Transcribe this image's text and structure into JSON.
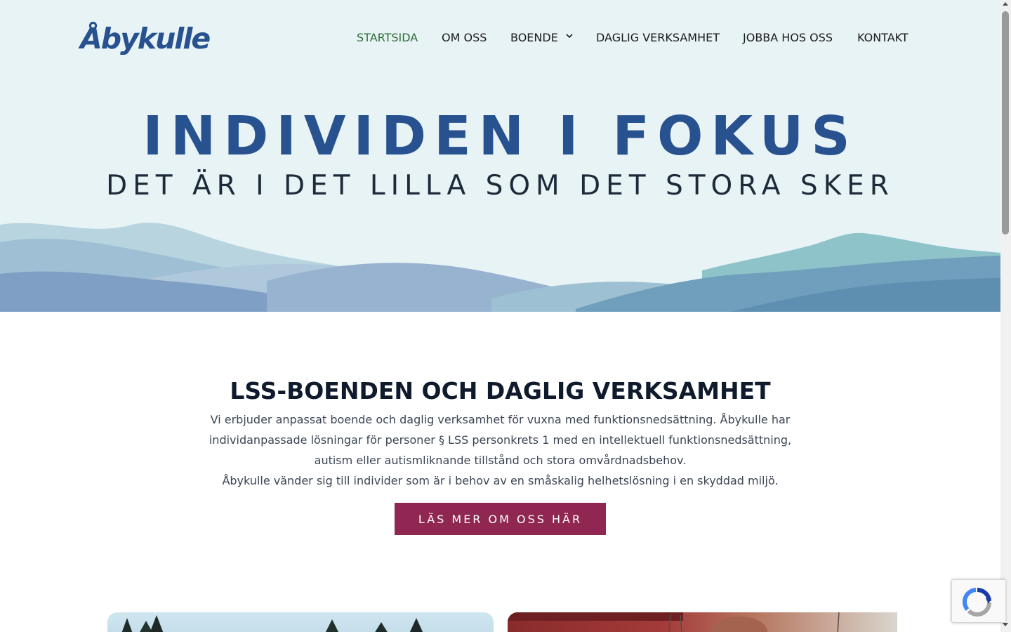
{
  "brand": {
    "logo_text": "Åbykulle"
  },
  "nav": {
    "items": [
      {
        "label": "STARTSIDA",
        "active": true
      },
      {
        "label": "OM OSS"
      },
      {
        "label": "BOENDE",
        "has_dropdown": true
      },
      {
        "label": "DAGLIG VERKSAMHET"
      },
      {
        "label": "JOBBA HOS OSS"
      },
      {
        "label": "KONTAKT"
      }
    ]
  },
  "hero": {
    "title": "INDIVIDEN I FOKUS",
    "subtitle": "DET ÄR I DET LILLA SOM DET STORA SKER"
  },
  "intro": {
    "heading": "LSS-BOENDEN OCH DAGLIG VERKSAMHET",
    "paragraph_1": "Vi erbjuder anpassat boende och daglig verksamhet för vuxna med funktionsnedsättning. Åbykulle har individanpassade lösningar för personer § LSS personkrets 1 med en intellektuell funktionsnedsättning, autism eller autismliknande tillstånd och stora omvårdnadsbehov.",
    "paragraph_2": "Åbykulle vänder sig till individer som är i behov av en småskalig helhetslösning i en skyddad miljö.",
    "cta_label": "LÄS MER OM OSS HÄR"
  },
  "colors": {
    "hero_bg": "#e8f3f6",
    "brand_blue": "#28518f",
    "nav_active": "#2d6b35",
    "cta_bg": "#8f2752"
  },
  "icons": {
    "dropdown": "chevron-down-icon",
    "recaptcha": "recaptcha-logo-icon"
  }
}
